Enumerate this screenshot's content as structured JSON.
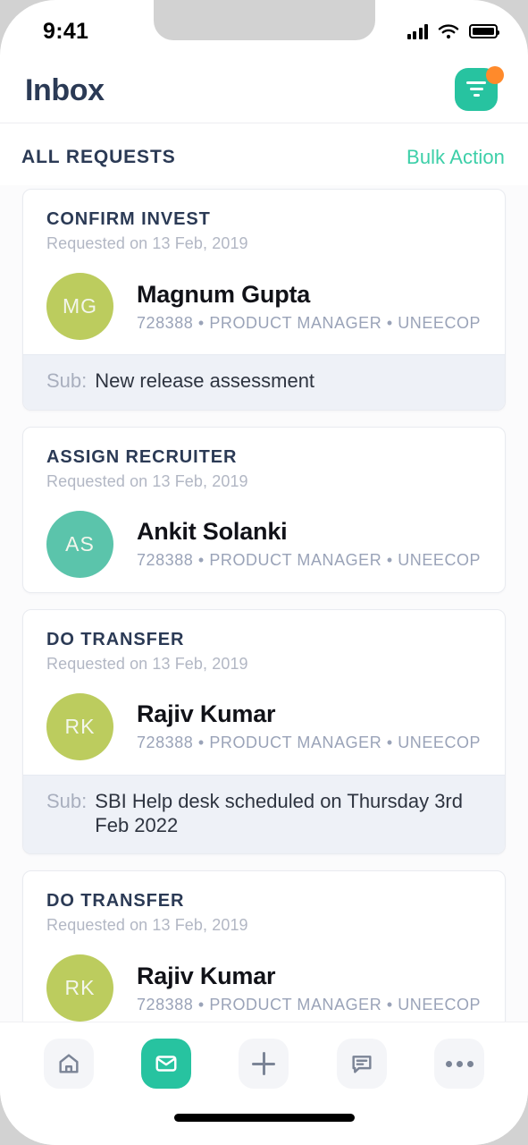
{
  "status_bar": {
    "time": "9:41",
    "signal_icon": "cellular-signal-icon",
    "wifi_icon": "wifi-icon",
    "battery_icon": "battery-icon"
  },
  "header": {
    "title": "Inbox",
    "filter_icon": "filter-icon",
    "filter_badge": "",
    "accent_color": "#27c3a0",
    "badge_color": "#ff8a2b",
    "title_color": "#2b3a55"
  },
  "section": {
    "title": "ALL REQUESTS",
    "bulk_action_label": "Bulk Action",
    "bulk_action_color": "#3ccfa8"
  },
  "requests": [
    {
      "type": "CONFIRM INVEST",
      "date": "Requested on 13 Feb, 2019",
      "avatar_initials": "MG",
      "avatar_color": "#bccc5e",
      "name": "Magnum Gupta",
      "employee_id": "728388",
      "role": "PRODUCT MANAGER",
      "company": "UNEECOPS…",
      "sub_label": "Sub:",
      "sub_value": "New release assessment"
    },
    {
      "type": "ASSIGN RECRUITER",
      "date": "Requested on 13 Feb, 2019",
      "avatar_initials": "AS",
      "avatar_color": "#5bc4ab",
      "name": "Ankit Solanki",
      "employee_id": "728388",
      "role": "PRODUCT MANAGER",
      "company": "UNEECOPS…",
      "sub_label": "",
      "sub_value": ""
    },
    {
      "type": "DO TRANSFER",
      "date": "Requested on 13 Feb, 2019",
      "avatar_initials": "RK",
      "avatar_color": "#bccc5e",
      "name": "Rajiv Kumar",
      "employee_id": "728388",
      "role": "PRODUCT MANAGER",
      "company": "UNEECOPS…",
      "sub_label": "Sub:",
      "sub_value": "SBI Help desk scheduled on Thursday 3rd Feb 2022"
    },
    {
      "type": "DO TRANSFER",
      "date": "Requested on 13 Feb, 2019",
      "avatar_initials": "RK",
      "avatar_color": "#bccc5e",
      "name": "Rajiv Kumar",
      "employee_id": "728388",
      "role": "PRODUCT MANAGER",
      "company": "UNEECOPS…",
      "sub_label": "",
      "sub_value": ""
    }
  ],
  "bottom_nav": {
    "items": [
      {
        "icon": "home-icon",
        "active": false
      },
      {
        "icon": "mail-icon",
        "active": true
      },
      {
        "icon": "plus-icon",
        "active": false
      },
      {
        "icon": "chat-icon",
        "active": false
      },
      {
        "icon": "more-icon",
        "active": false
      }
    ]
  },
  "separators": {
    "meta_bullet": "•"
  }
}
